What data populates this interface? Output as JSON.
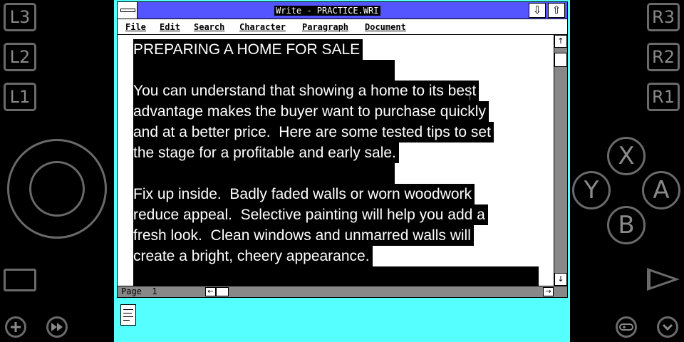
{
  "gamepad": {
    "l3": "L3",
    "l2": "L2",
    "l1": "L1",
    "r3": "R3",
    "r2": "R2",
    "r1": "R1",
    "x": "X",
    "y": "Y",
    "a": "A",
    "b": "B",
    "add_icon": "plus-icon",
    "ff_icon": "fast-forward-icon",
    "controller_icon": "gamepad-icon",
    "chevron_icon": "chevron-down-icon"
  },
  "window": {
    "title": "Write - PRACTICE.WRI",
    "minimize_glyph": "⇩",
    "maximize_glyph": "⇧"
  },
  "menubar": {
    "items": [
      "File",
      "Edit",
      "Search",
      "Character",
      "Paragraph",
      "Document"
    ]
  },
  "document": {
    "lines": [
      "PREPARING A HOME FOR SALE",
      "",
      "You can understand that showing a home to its best",
      "advantage makes the buyer want to purchase quickly",
      "and at a better price.  Here are some tested tips to set",
      "the stage for a profitable and early sale.",
      "",
      "Fix up inside.  Badly faded walls or worn woodwork",
      "reduce appeal.  Selective painting will help you add a",
      "fresh look.  Clean windows and unmarred walls will",
      "create a bright, cheery appearance.",
      ""
    ]
  },
  "scrollbars": {
    "up_glyph": "↑",
    "down_glyph": "↓",
    "left_glyph": "←",
    "right_glyph": "→"
  },
  "status": {
    "page": "Page  1"
  }
}
